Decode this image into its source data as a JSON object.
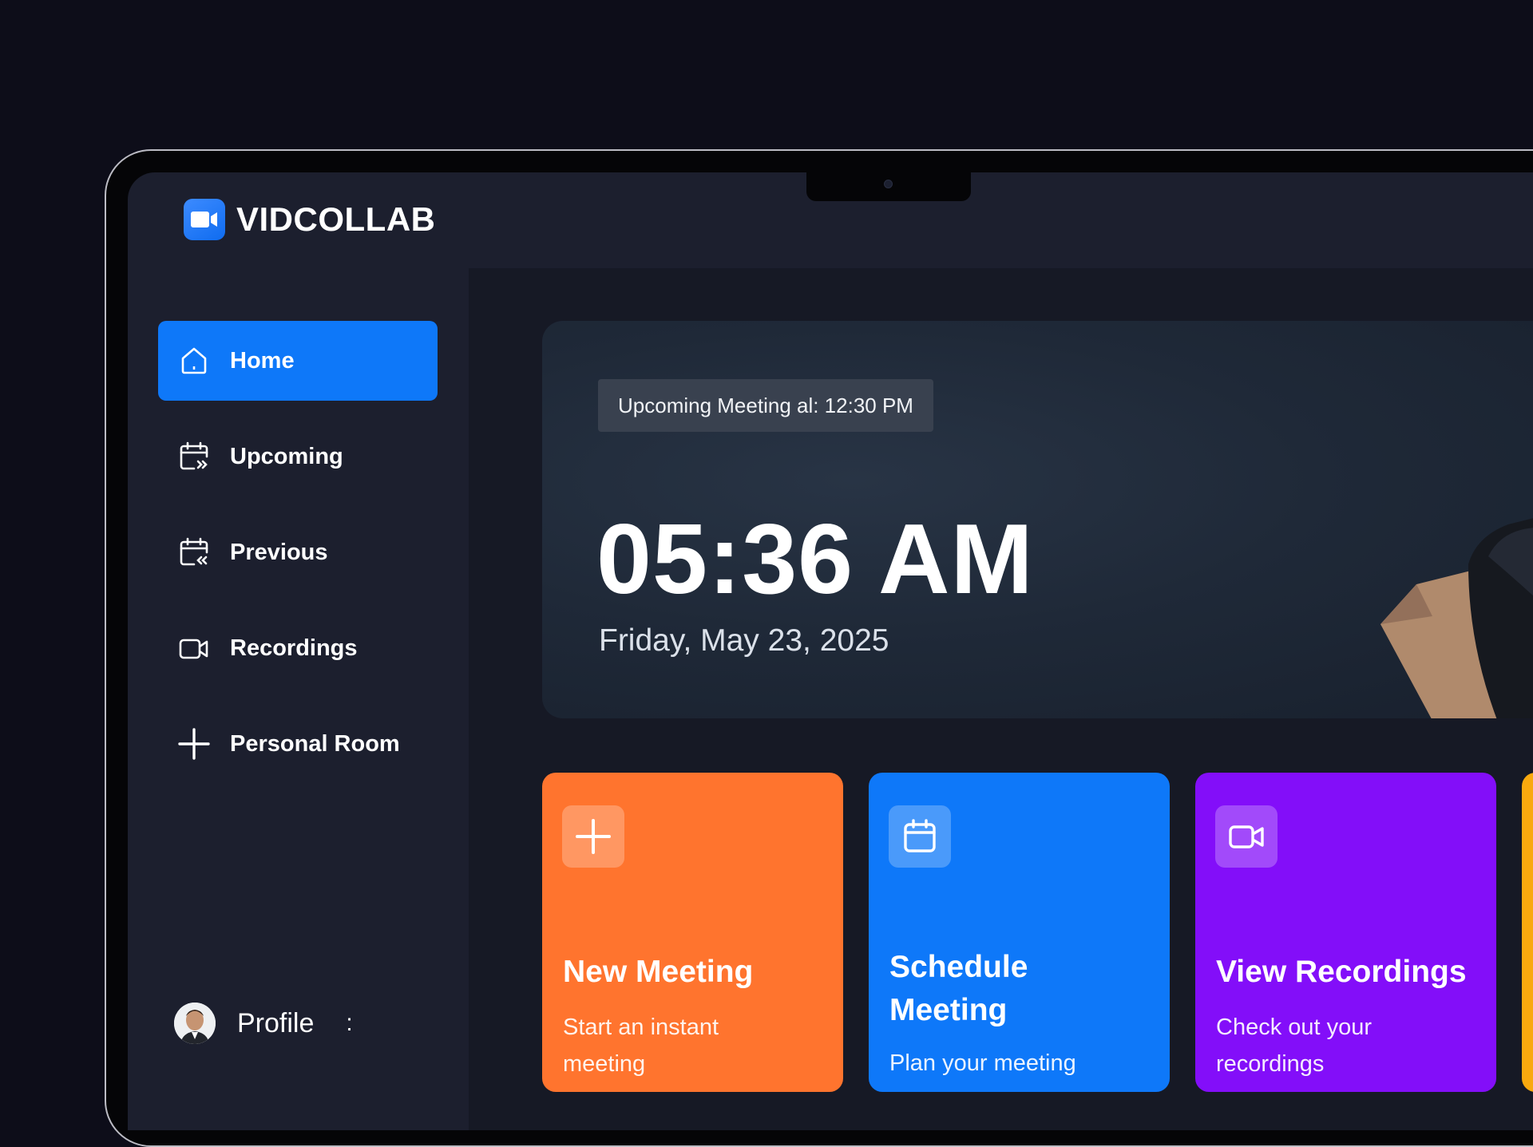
{
  "app": {
    "name": "VIDCOLLAB",
    "logo_icon": "video-camera-icon",
    "accent": "#0e78f9"
  },
  "sidebar": {
    "items": [
      {
        "label": "Home",
        "icon": "home-icon",
        "active": true
      },
      {
        "label": "Upcoming",
        "icon": "calendar-upcoming-icon",
        "active": false
      },
      {
        "label": "Previous",
        "icon": "calendar-previous-icon",
        "active": false
      },
      {
        "label": "Recordings",
        "icon": "video-icon",
        "active": false
      },
      {
        "label": "Personal Room",
        "icon": "plus-icon",
        "active": false
      }
    ],
    "profile": {
      "label": "Profile",
      "more": ":"
    }
  },
  "hero": {
    "badge": "Upcoming Meeting al: 12:30 PM",
    "time": "05:36 AM",
    "date": "Friday, May 23, 2025"
  },
  "cards": [
    {
      "title": "New Meeting",
      "description": "Start an instant meeting",
      "icon": "plus-icon",
      "color": "#ff742e"
    },
    {
      "title": "Schedule Meeting",
      "description": "Plan your meeting",
      "icon": "calendar-icon",
      "color": "#0e78f9"
    },
    {
      "title": "View Recordings",
      "description": "Check out your recordings",
      "icon": "video-icon",
      "color": "#830ef9"
    }
  ]
}
